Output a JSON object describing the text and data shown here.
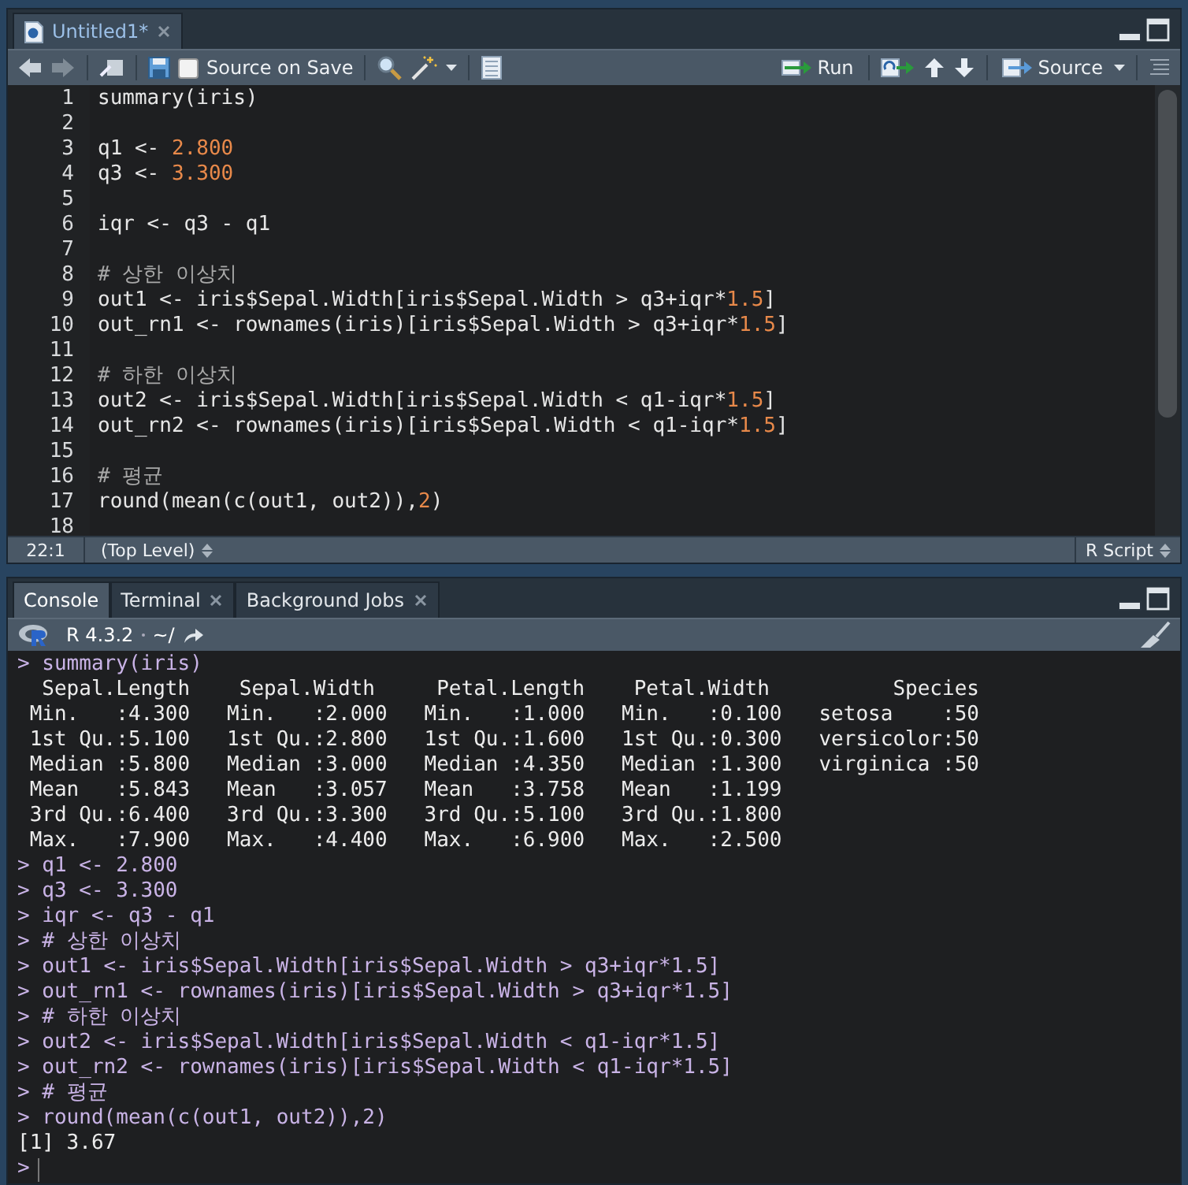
{
  "editor": {
    "tabs": [
      {
        "label": "Untitled1*",
        "selected": true
      }
    ],
    "toolbar": {
      "source_on_save": {
        "label": "Source on Save",
        "checked": false
      },
      "run": "Run",
      "source": "Source"
    },
    "lines": [
      {
        "number": "1",
        "tokens": [
          {
            "text": "summary(iris)",
            "kind": "plain"
          }
        ]
      },
      {
        "number": "2"
      },
      {
        "number": "3",
        "tokens": [
          {
            "text": "q1 <- ",
            "kind": "plain"
          },
          {
            "text": "2.800",
            "kind": "number"
          }
        ]
      },
      {
        "number": "4",
        "tokens": [
          {
            "text": "q3 <- ",
            "kind": "plain"
          },
          {
            "text": "3.300",
            "kind": "number"
          }
        ]
      },
      {
        "number": "5"
      },
      {
        "number": "6",
        "tokens": [
          {
            "text": "iqr <- q3 - q1",
            "kind": "plain"
          }
        ]
      },
      {
        "number": "7"
      },
      {
        "number": "8",
        "tokens": [
          {
            "text": "# 상한 이상치",
            "kind": "comment"
          }
        ]
      },
      {
        "number": "9",
        "tokens": [
          {
            "text": "out1 <- iris$Sepal.Width[iris$Sepal.Width > q3+iqr*",
            "kind": "plain"
          },
          {
            "text": "1.5",
            "kind": "number"
          },
          {
            "text": "]",
            "kind": "plain"
          }
        ]
      },
      {
        "number": "10",
        "tokens": [
          {
            "text": "out_rn1 <- rownames(iris)[iris$Sepal.Width > q3+iqr*",
            "kind": "plain"
          },
          {
            "text": "1.5",
            "kind": "number"
          },
          {
            "text": "]",
            "kind": "plain"
          }
        ]
      },
      {
        "number": "11"
      },
      {
        "number": "12",
        "tokens": [
          {
            "text": "# 하한 이상치",
            "kind": "comment"
          }
        ]
      },
      {
        "number": "13",
        "tokens": [
          {
            "text": "out2 <- iris$Sepal.Width[iris$Sepal.Width < q1-iqr*",
            "kind": "plain"
          },
          {
            "text": "1.5",
            "kind": "number"
          },
          {
            "text": "]",
            "kind": "plain"
          }
        ]
      },
      {
        "number": "14",
        "tokens": [
          {
            "text": "out_rn2 <- rownames(iris)[iris$Sepal.Width < q1-iqr*",
            "kind": "plain"
          },
          {
            "text": "1.5",
            "kind": "number"
          },
          {
            "text": "]",
            "kind": "plain"
          }
        ]
      },
      {
        "number": "15"
      },
      {
        "number": "16",
        "tokens": [
          {
            "text": "# 평균",
            "kind": "comment"
          }
        ]
      },
      {
        "number": "17",
        "tokens": [
          {
            "text": "round(mean(c(out1, out2)),",
            "kind": "plain"
          },
          {
            "text": "2",
            "kind": "number"
          },
          {
            "text": ")",
            "kind": "plain"
          }
        ]
      },
      {
        "number": "18"
      }
    ],
    "status_bar": {
      "position": "22:1",
      "scope": "(Top Level)",
      "file_type": "R Script"
    }
  },
  "console": {
    "tabs": [
      {
        "label": "Console",
        "selected": true,
        "closable": false
      },
      {
        "label": "Terminal",
        "selected": false,
        "closable": true
      },
      {
        "label": "Background Jobs",
        "selected": false,
        "closable": true
      }
    ],
    "version": "R 4.3.2",
    "path": "~/",
    "lines": [
      {
        "kind": "input",
        "text": "> summary(iris)"
      },
      {
        "kind": "output",
        "text": "  Sepal.Length    Sepal.Width     Petal.Length    Petal.Width          Species  "
      },
      {
        "kind": "output",
        "text": " Min.   :4.300   Min.   :2.000   Min.   :1.000   Min.   :0.100   setosa    :50  "
      },
      {
        "kind": "output",
        "text": " 1st Qu.:5.100   1st Qu.:2.800   1st Qu.:1.600   1st Qu.:0.300   versicolor:50  "
      },
      {
        "kind": "output",
        "text": " Median :5.800   Median :3.000   Median :4.350   Median :1.300   virginica :50  "
      },
      {
        "kind": "output",
        "text": " Mean   :5.843   Mean   :3.057   Mean   :3.758   Mean   :1.199                  "
      },
      {
        "kind": "output",
        "text": " 3rd Qu.:6.400   3rd Qu.:3.300   3rd Qu.:5.100   3rd Qu.:1.800                  "
      },
      {
        "kind": "output",
        "text": " Max.   :7.900   Max.   :4.400   Max.   :6.900   Max.   :2.500                  "
      },
      {
        "kind": "input",
        "text": "> q1 <- 2.800"
      },
      {
        "kind": "input",
        "text": "> q3 <- 3.300"
      },
      {
        "kind": "input",
        "text": "> iqr <- q3 - q1"
      },
      {
        "kind": "input",
        "text": "> # 상한 이상치"
      },
      {
        "kind": "input",
        "text": "> out1 <- iris$Sepal.Width[iris$Sepal.Width > q3+iqr*1.5]"
      },
      {
        "kind": "input",
        "text": "> out_rn1 <- rownames(iris)[iris$Sepal.Width > q3+iqr*1.5]"
      },
      {
        "kind": "input",
        "text": "> # 하한 이상치"
      },
      {
        "kind": "input",
        "text": "> out2 <- iris$Sepal.Width[iris$Sepal.Width < q1-iqr*1.5]"
      },
      {
        "kind": "input",
        "text": "> out_rn2 <- rownames(iris)[iris$Sepal.Width < q1-iqr*1.5]"
      },
      {
        "kind": "input",
        "text": "> # 평균"
      },
      {
        "kind": "input",
        "text": "> round(mean(c(out1, out2)),2)"
      },
      {
        "kind": "output",
        "text": "[1] 3.67"
      },
      {
        "kind": "prompt",
        "text": ">"
      }
    ]
  }
}
